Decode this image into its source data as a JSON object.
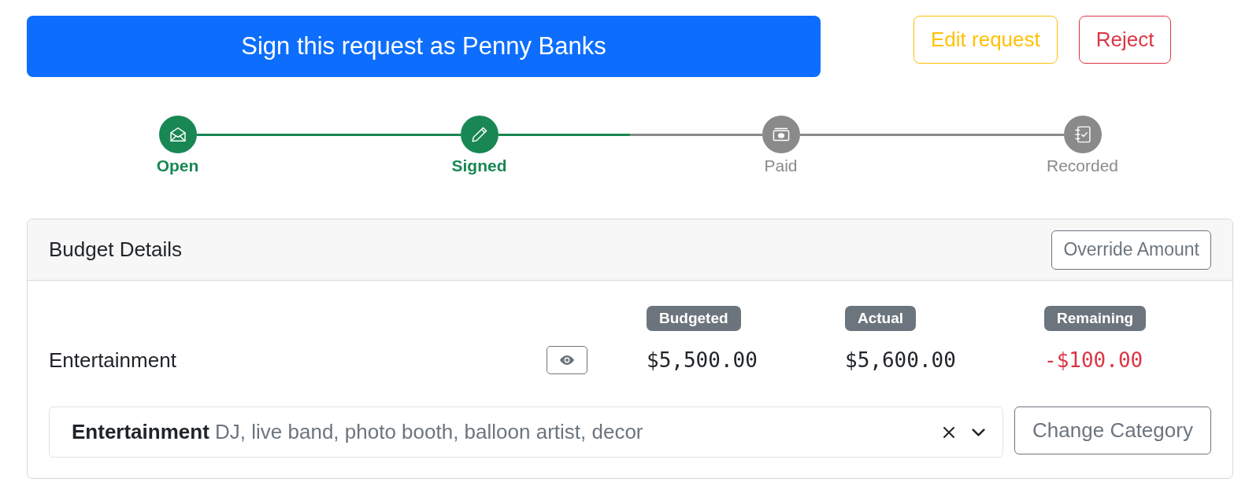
{
  "header": {
    "sign_button": "Sign this request as Penny Banks",
    "actions": [
      {
        "label": "Edit request",
        "kind": "warning"
      },
      {
        "label": "Reject",
        "kind": "danger"
      }
    ]
  },
  "progress": {
    "steps": [
      {
        "label": "Open",
        "completed": true
      },
      {
        "label": "Signed",
        "completed": true
      },
      {
        "label": "Paid",
        "completed": false
      },
      {
        "label": "Recorded",
        "completed": false
      }
    ]
  },
  "budget_details": {
    "title": "Budget Details",
    "override_button": "Override Amount",
    "columns": [
      "Budgeted",
      "Actual",
      "Remaining"
    ],
    "rows": [
      {
        "category": "Entertainment",
        "amounts": [
          {
            "text": "$5,500.00",
            "negative": false
          },
          {
            "text": "$5,600.00",
            "negative": false
          },
          {
            "text": "-$100.00",
            "negative": true
          }
        ]
      }
    ],
    "category_select": {
      "name": "Entertainment",
      "description": "DJ, live band, photo booth, balloon artist, decor"
    },
    "change_button": "Change Category"
  }
}
